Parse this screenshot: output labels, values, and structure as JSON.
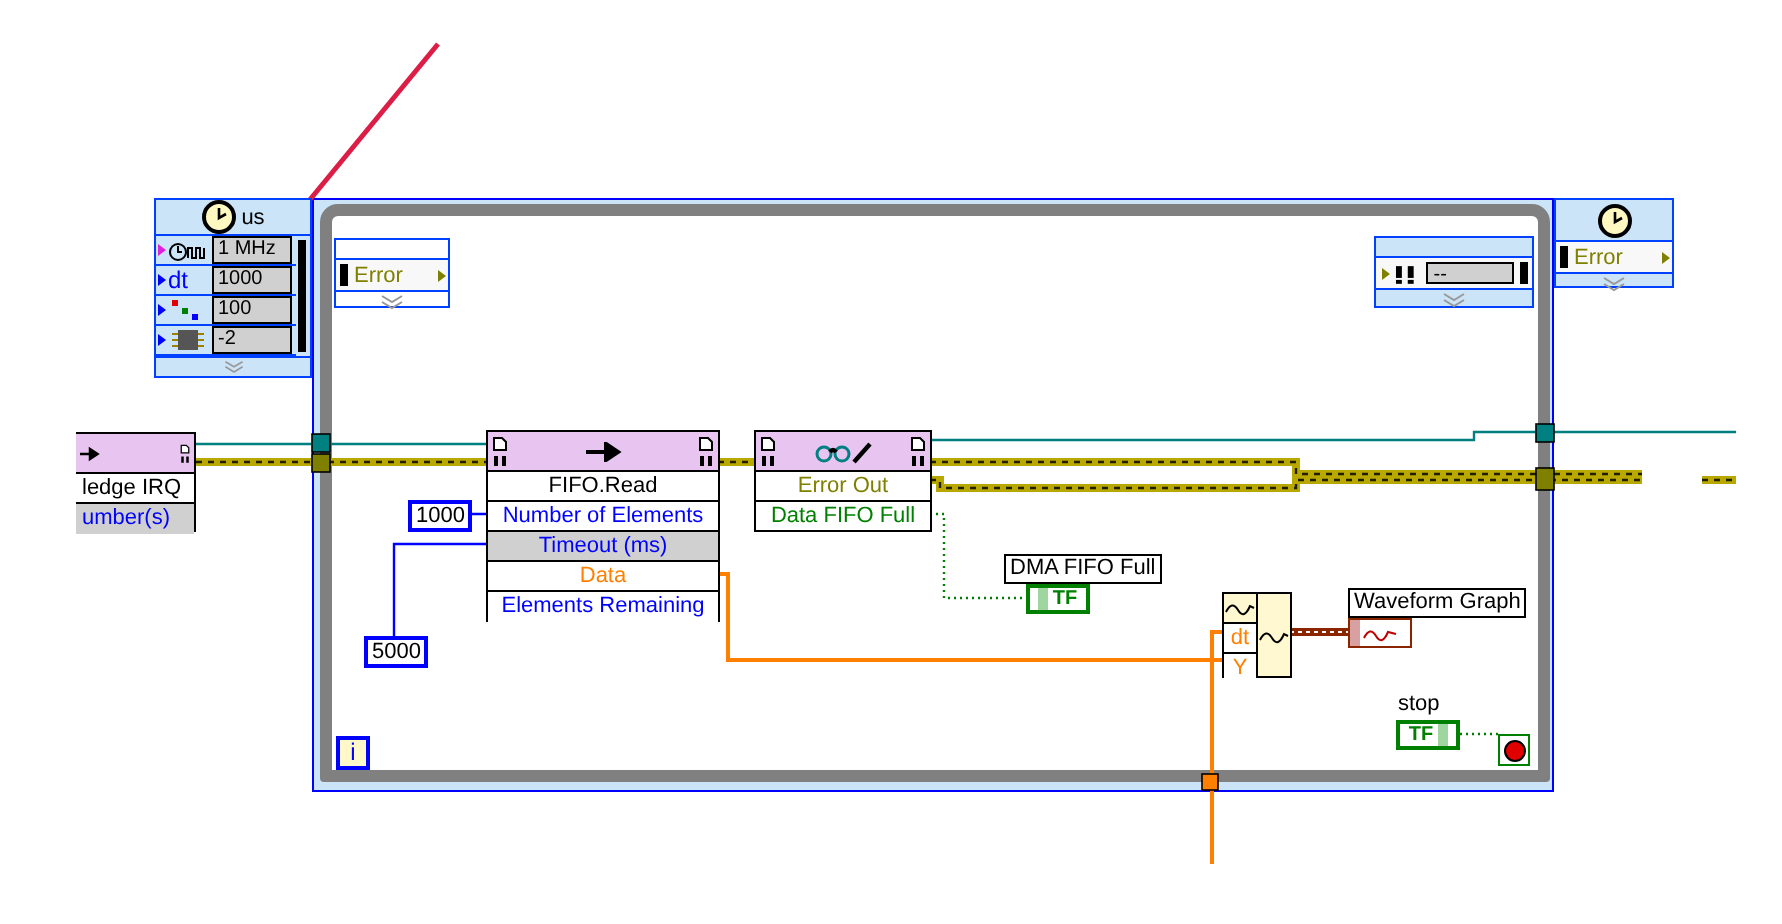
{
  "timed_loop_input": {
    "unit": "us",
    "rows": [
      {
        "kind": "clock",
        "value": "1 MHz"
      },
      {
        "kind": "dt",
        "label": "dt",
        "value": "1000"
      },
      {
        "kind": "priority",
        "value": "100"
      },
      {
        "kind": "processor",
        "value": "-2"
      }
    ]
  },
  "loop_left_node": {
    "label": "Error"
  },
  "loop_right_node": {
    "value": "--"
  },
  "loop_output_node": {
    "label": "Error"
  },
  "irq_node": {
    "rows": [
      {
        "label": "ledge IRQ",
        "highlighted": false
      },
      {
        "label": "umber(s)",
        "highlighted": true
      }
    ]
  },
  "fifo_read": {
    "title": "FIFO.Read",
    "rows": [
      {
        "label": "Number of Elements",
        "color": "#0000ff",
        "highlighted": false
      },
      {
        "label": "Timeout (ms)",
        "color": "#0000ff",
        "highlighted": true
      },
      {
        "label": "Data",
        "color": "#ff7f00",
        "highlighted": false
      },
      {
        "label": "Elements Remaining",
        "color": "#0000ff",
        "highlighted": false
      }
    ]
  },
  "constants": [
    {
      "value": "1000"
    },
    {
      "value": "5000"
    }
  ],
  "status_node": {
    "rows": [
      {
        "label": "Error Out",
        "color": "#808000"
      },
      {
        "label": "Data FIFO Full",
        "color": "#008000"
      }
    ]
  },
  "dma_fifo_full": {
    "label": "DMA FIFO Full",
    "glyph": "TF"
  },
  "build_waveform": {
    "inputs": [
      "dt",
      "Y"
    ]
  },
  "waveform_graph": {
    "label": "Waveform Graph"
  },
  "stop": {
    "label": "stop",
    "glyph": "TF"
  },
  "iteration": {
    "label": "i"
  }
}
